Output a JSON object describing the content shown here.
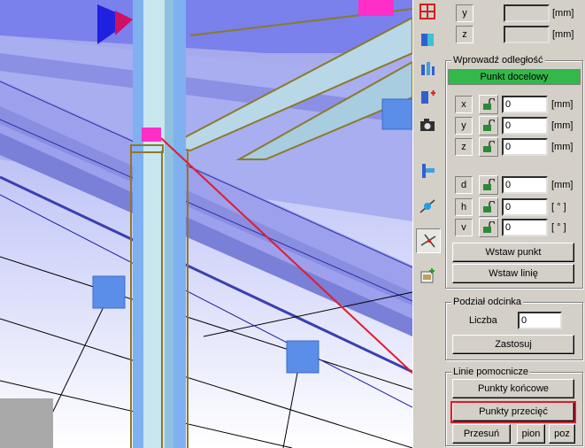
{
  "viewport": {
    "label": "3d-model-view"
  },
  "toolbar": {
    "buttons": [
      {
        "name": "grid-icon"
      },
      {
        "name": "section-view-icon"
      },
      {
        "name": "columns-icon"
      },
      {
        "name": "add-point-icon"
      },
      {
        "name": "camera-icon"
      },
      {
        "name": "align-icon"
      },
      {
        "name": "snap-point-icon"
      },
      {
        "name": "intersection-icon"
      },
      {
        "name": "add-object-icon"
      }
    ],
    "active_index": 7
  },
  "coords_top": {
    "rows": [
      {
        "label": "y",
        "value": "",
        "unit": "[mm]"
      },
      {
        "label": "z",
        "value": "",
        "unit": "[mm]"
      }
    ]
  },
  "distance": {
    "title": "Wprowadź odległość",
    "target_label": "Punkt docelowy",
    "accent": "#33b84a",
    "rows": [
      {
        "label": "x",
        "value": "0",
        "unit": "[mm]"
      },
      {
        "label": "y",
        "value": "0",
        "unit": "[mm]"
      },
      {
        "label": "z",
        "value": "0",
        "unit": "[mm]"
      },
      {
        "label": "d",
        "value": "0",
        "unit": "[mm]"
      },
      {
        "label": "h",
        "value": "0",
        "unit": "[ ° ]"
      },
      {
        "label": "v",
        "value": "0",
        "unit": "[ ° ]"
      }
    ],
    "insert_point": "Wstaw punkt",
    "insert_line": "Wstaw linię"
  },
  "segment": {
    "title": "Podział odcinka",
    "count_label": "Liczba",
    "count_value": "0",
    "apply": "Zastosuj"
  },
  "guides": {
    "title": "Linie pomocnicze",
    "endpoints": "Punkty końcowe",
    "intersections": "Punkty przecięć",
    "move": "Przesuń",
    "vertical": "pion",
    "horizontal": "poz",
    "highlight_color": "#e21b2b"
  }
}
